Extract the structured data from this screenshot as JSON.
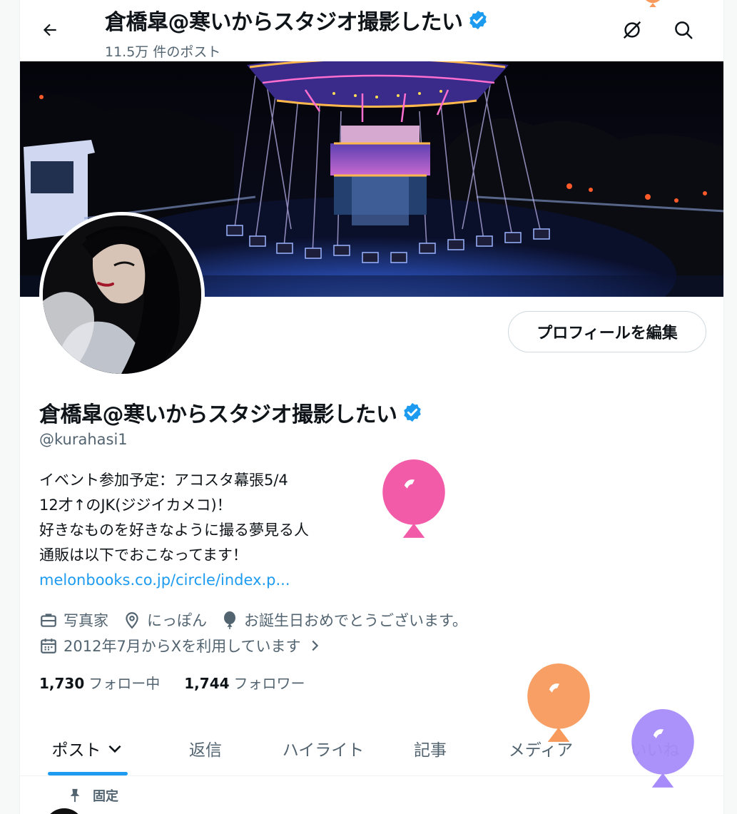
{
  "header": {
    "title": "倉橋皐@寒いからスタジオ撮影したい",
    "post_count": "11.5万 件のポスト",
    "back_icon": "arrow-left-icon",
    "grok_icon": "slash-circle-icon",
    "search_icon": "search-icon"
  },
  "profile": {
    "edit_button": "プロフィールを編集",
    "name": "倉橋皐@寒いからスタジオ撮影したい",
    "handle": "@kurahasi1",
    "bio_lines": [
      "イベント参加予定：アコスタ幕張5/4",
      "12才↑のJK(ジジイカメコ)！",
      "好きなものを好きなように撮る夢見る人",
      "通販は以下でおこなってます！"
    ],
    "bio_link": "melonbooks.co.jp/circle/index.p...",
    "profession": "写真家",
    "location": "にっぽん",
    "birthday": "お誕生日おめでとうございます。",
    "joined": "2012年7月からXを利用しています",
    "following_count": "1,730",
    "following_label": "フォロー中",
    "followers_count": "1,744",
    "followers_label": "フォロワー"
  },
  "tabs": [
    "ポスト",
    "返信",
    "ハイライト",
    "記事",
    "メディア",
    "いいね"
  ],
  "pinned_label": "固定",
  "colors": {
    "accent": "#1d9bf0",
    "verified": "#1d9bf0",
    "balloon_pink": "#f25ba8",
    "balloon_orange": "#f79a5c",
    "balloon_purple": "#a78bfa"
  }
}
